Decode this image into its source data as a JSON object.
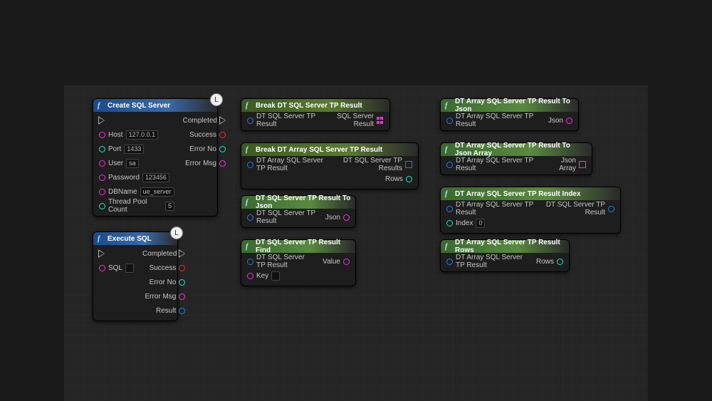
{
  "nodes": {
    "createSql": {
      "title": "Create SQL Server",
      "exec_in": true,
      "exec_out_label": "Completed",
      "inputs": [
        {
          "label": "Host",
          "value": "127.0.0.1",
          "pin": "magenta"
        },
        {
          "label": "Port",
          "value": "1433",
          "pin": "cyan"
        },
        {
          "label": "User",
          "value": "sa",
          "pin": "magenta"
        },
        {
          "label": "Password",
          "value": "123456",
          "pin": "magenta"
        },
        {
          "label": "DBName",
          "value": "ue_server",
          "pin": "magenta"
        },
        {
          "label": "Thread Pool Count",
          "value": "5",
          "pin": "cyan"
        }
      ],
      "outputs": [
        {
          "label": "Success",
          "pin": "red"
        },
        {
          "label": "Error No",
          "pin": "cyan"
        },
        {
          "label": "Error Msg",
          "pin": "magenta"
        }
      ]
    },
    "executeSql": {
      "title": "Execute SQL",
      "exec_in": true,
      "exec_out_label": "Completed",
      "inputs": [
        {
          "label": "SQL",
          "value": "",
          "pin": "magenta"
        }
      ],
      "outputs": [
        {
          "label": "Success",
          "pin": "red"
        },
        {
          "label": "Error No",
          "pin": "cyan"
        },
        {
          "label": "Error Msg",
          "pin": "magenta"
        },
        {
          "label": "Result",
          "pin": "blue"
        }
      ]
    },
    "breakResult": {
      "title": "Break DT SQL Server TP Result",
      "inputs": [
        {
          "label": "DT SQL Server TP Result",
          "pin": "blue"
        }
      ],
      "outputs": [
        {
          "label": "SQL Server Result",
          "pin": "struct"
        }
      ]
    },
    "breakArrayResult": {
      "title": "Break DT Array SQL Server TP Result",
      "inputs": [
        {
          "label": "DT Array SQL Server TP Result",
          "pin": "blue"
        }
      ],
      "outputs": [
        {
          "label": "DT SQL Server TP Results",
          "pin": "array-blue"
        },
        {
          "label": "Rows",
          "pin": "cyan"
        }
      ]
    },
    "resultToJson": {
      "title": "DT SQL Server TP Result To Json",
      "inputs": [
        {
          "label": "DT SQL Server TP Result",
          "pin": "blue"
        }
      ],
      "outputs": [
        {
          "label": "Json",
          "pin": "magenta"
        }
      ]
    },
    "resultFind": {
      "title": "DT SQL Server TP Result Find",
      "inputs": [
        {
          "label": "DT SQL Server TP Result",
          "pin": "blue"
        },
        {
          "label": "Key",
          "value": "",
          "pin": "magenta"
        }
      ],
      "outputs": [
        {
          "label": "Value",
          "pin": "magenta"
        }
      ]
    },
    "arrayToJson": {
      "title": "DT Array SQL Server TP Result To Json",
      "inputs": [
        {
          "label": "DT Array SQL Server TP Result",
          "pin": "blue"
        }
      ],
      "outputs": [
        {
          "label": "Json",
          "pin": "magenta"
        }
      ]
    },
    "arrayToJsonArray": {
      "title": "DT Array SQL Server TP Result To Json Array",
      "inputs": [
        {
          "label": "DT Array SQL Server TP Result",
          "pin": "blue"
        }
      ],
      "outputs": [
        {
          "label": "Json Array",
          "pin": "array-magenta"
        }
      ]
    },
    "arrayIndex": {
      "title": "DT Array SQL Server TP Result Index",
      "inputs": [
        {
          "label": "DT Array SQL Server TP Result",
          "pin": "blue"
        },
        {
          "label": "Index",
          "value": "0",
          "pin": "cyan"
        }
      ],
      "outputs": [
        {
          "label": "DT SQL Server TP Result",
          "pin": "blue"
        }
      ]
    },
    "arrayRows": {
      "title": "DT Array SQL Server TP Result Rows",
      "inputs": [
        {
          "label": "DT Array SQL Server TP Result",
          "pin": "blue"
        }
      ],
      "outputs": [
        {
          "label": "Rows",
          "pin": "cyan"
        }
      ]
    }
  },
  "latent_badge": "L"
}
